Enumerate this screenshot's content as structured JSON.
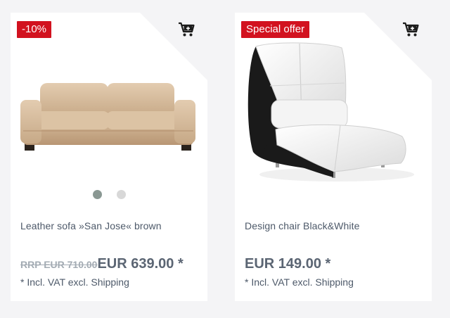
{
  "products": [
    {
      "badge": "-10%",
      "image": "leather-sofa-photo",
      "title": "Leather sofa »San Jose« brown",
      "old_price": "RRP EUR 710.00",
      "price": "EUR 639.00 *",
      "vat_note": "* Incl. VAT excl. Shipping",
      "slider_dots": 2,
      "active_dot": 0
    },
    {
      "badge": "Special offer",
      "image": "design-chair-photo",
      "title": "Design chair Black&White",
      "old_price": "",
      "price": "EUR 149.00 *",
      "vat_note": "* Incl. VAT excl. Shipping"
    }
  ],
  "icons": {
    "cart": "add-to-cart-icon"
  },
  "colors": {
    "badge": "#d2121f",
    "price": "#5b6573",
    "text": "#4d5969",
    "dot_active": "#8a9893",
    "dot_inactive": "#d8d8d8"
  }
}
